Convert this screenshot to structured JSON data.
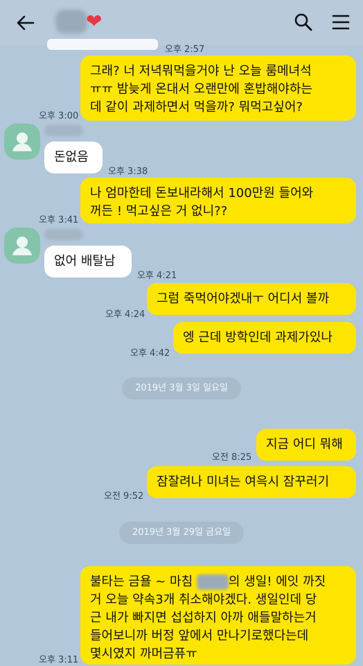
{
  "top_partial_time": "오후 2:57",
  "messages": [
    {
      "id": "m1",
      "text": "그래? 너 저녁뭐먹을거야 난 오늘 룸메녀석\nㅠㅠ 밤늦게 온대서 오랜만에 혼밥해야하는\n데 같이 과제하면서 먹을까? 뭐먹고싶어?",
      "time": "오후 3:00"
    },
    {
      "id": "m2",
      "text": "돈없음",
      "time": "오후 3:38"
    },
    {
      "id": "m3",
      "text": "나 엄마한테 돈보내라해서 100만원 들어와\n꺼든 ! 먹고싶은 거 없니??",
      "time": "오후 3:41"
    },
    {
      "id": "m4",
      "text": "없어 배탈남",
      "time": "오후 4:21"
    },
    {
      "id": "m5",
      "text": "그럼 죽먹어야겠내ㅜ 어디서 볼까",
      "time": "오후 4:24"
    },
    {
      "id": "m6",
      "text": "엥 근데 방학인데 과제가있나",
      "time": "오후 4:42"
    },
    {
      "id": "m7",
      "text": "지금 어디 뭐해",
      "time": "오전 8:25"
    },
    {
      "id": "m8",
      "text": "잠잘려나 미녀는 여윽시 잠꾸러기",
      "time": "오전 9:52"
    },
    {
      "id": "m9",
      "text_a": "불타는 금욜 ~ 마침 ",
      "text_b": "의 생일! 에잇 까짓\n거 오늘 약속3개 취소해야겠다. 생일인데 당\n근 내가 빠지면 섭섭하지 아까 애들말하는거\n들어보니까 버정 앞에서 만나기로했다는데\n몇시였지 까머금퓨ㅠ",
      "time": "오후 3:11"
    }
  ],
  "dates": [
    "2019년 3월 3일 일요일",
    "2019년 3월 29일 금요일"
  ],
  "colors": {
    "background": "#b2c7d9",
    "my_bubble": "#fee500",
    "other_bubble": "#ffffff",
    "heart": "#e63946"
  },
  "icons": [
    "back-arrow-icon",
    "heart-icon",
    "search-icon",
    "menu-icon",
    "profile-avatar-icon"
  ]
}
